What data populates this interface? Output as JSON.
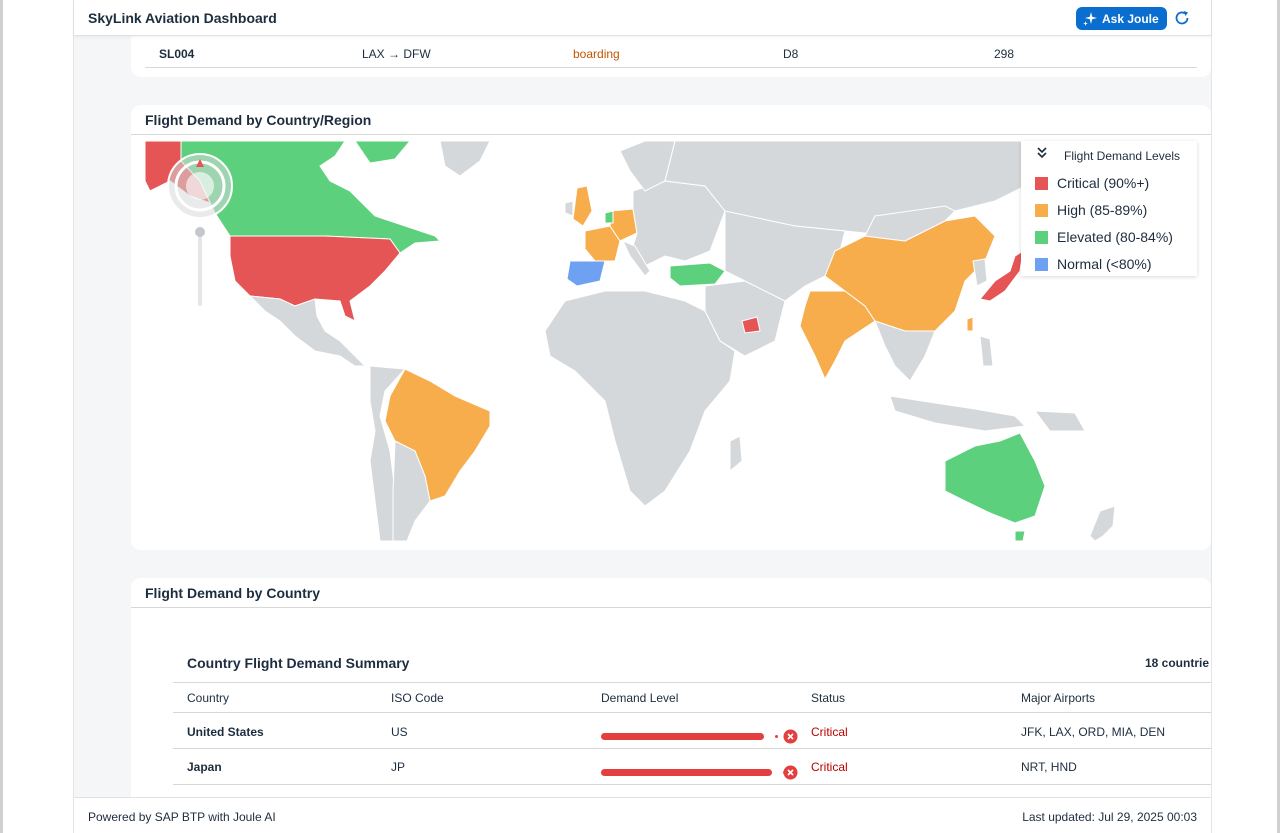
{
  "header": {
    "title": "SkyLink Aviation Dashboard",
    "ask_label": "Ask Joule",
    "accent": "#0a6ed1"
  },
  "flight_row": {
    "flight": "SL004",
    "route": "LAX → DFW",
    "status": "boarding",
    "gate": "D8",
    "passengers": "298",
    "status_color": "#c35500"
  },
  "map_card": {
    "title": "Flight Demand by Country/Region",
    "legend": {
      "title": "Flight Demand Levels",
      "items": [
        {
          "label": "Critical (90%+)",
          "color": "#e55555"
        },
        {
          "label": "High (85-89%)",
          "color": "#f7ad4c"
        },
        {
          "label": "Elevated (80-84%)",
          "color": "#5cd07c"
        },
        {
          "label": "Normal (<80%)",
          "color": "#6fa1f2"
        }
      ]
    },
    "base_land_color": "#d5d8da"
  },
  "country_card": {
    "title": "Flight Demand by Country",
    "summary_title": "Country Flight Demand Summary",
    "summary_count": "18 countrie",
    "columns": [
      "Country",
      "ISO Code",
      "Demand Level",
      "Status",
      "Major Airports"
    ],
    "rows": [
      {
        "country": "United States",
        "iso": "US",
        "demand": 0.83,
        "status": "Critical",
        "airports": "JFK, LAX, ORD, MIA, DEN"
      },
      {
        "country": "Japan",
        "iso": "JP",
        "demand": 0.87,
        "status": "Critical",
        "airports": "NRT, HND"
      }
    ]
  },
  "footer": {
    "left": "Powered by SAP BTP with Joule AI",
    "right": "Last updated: Jul 29, 2025 00:03"
  }
}
